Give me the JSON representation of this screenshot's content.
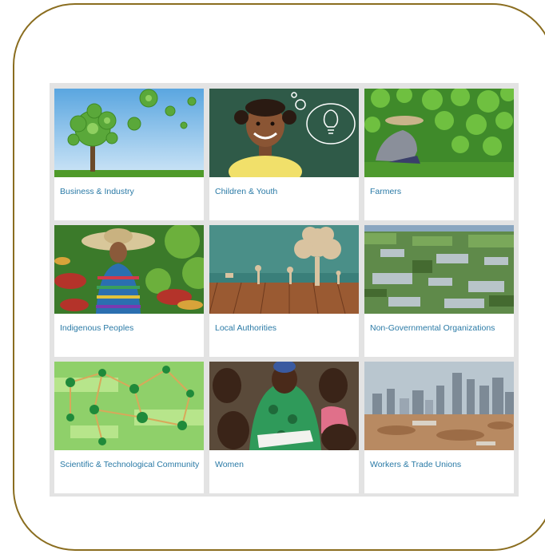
{
  "cards": [
    {
      "label": "Business & Industry",
      "image": "green-gear-tree-illustration"
    },
    {
      "label": "Children & Youth",
      "image": "girl-with-lightbulb-thought-bubble"
    },
    {
      "label": "Farmers",
      "image": "farmer-in-field"
    },
    {
      "label": "Indigenous Peoples",
      "image": "woman-in-sombrero-among-plants"
    },
    {
      "label": "Local Authorities",
      "image": "paper-tree-on-wooden-floor"
    },
    {
      "label": "Non-Governmental Organizations",
      "image": "aerial-farmland-view"
    },
    {
      "label": "Scientific & Technological Community",
      "image": "green-molecule-network"
    },
    {
      "label": "Women",
      "image": "women-and-children-reading-book"
    },
    {
      "label": "Workers & Trade Unions",
      "image": "city-construction-site"
    }
  ],
  "colors": {
    "frame": "#8a6d1f",
    "link": "#2a7aa6",
    "panel": "#e3e3e3"
  }
}
